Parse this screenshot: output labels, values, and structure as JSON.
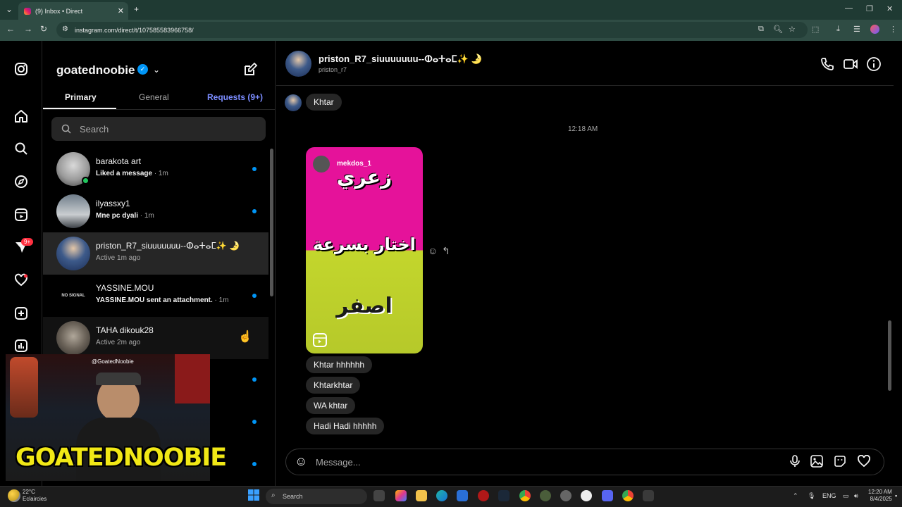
{
  "browser": {
    "tab_title": "(9) Inbox • Direct",
    "url": "instagram.com/direct/t/107585583966758/"
  },
  "rail": {
    "notification_badge": "9+"
  },
  "inbox": {
    "username": "goatednoobie",
    "tabs": [
      {
        "label": "Primary"
      },
      {
        "label": "General"
      },
      {
        "label": "Requests (9+)"
      }
    ],
    "search_placeholder": "Search",
    "threads": [
      {
        "name": "barakota art",
        "preview": "Liked a message",
        "time": " · 1m",
        "unread": true
      },
      {
        "name": "ilyassxy1",
        "preview": "Mne pc dyali",
        "time": " · 1m",
        "unread": true
      },
      {
        "name": "priston_R7_siuuuuuuu--ⵀⴰⵜⴰⵎ✨ 🌛",
        "preview": "Active 1m ago",
        "time": "",
        "unread": false
      },
      {
        "name": "YASSINE.MOU",
        "preview": "YASSINE.MOU sent an attachment.",
        "time": " · 1m",
        "unread": true
      },
      {
        "name": "TAHA dikouk28",
        "preview": "Active 2m ago",
        "time": "",
        "unread": false
      }
    ],
    "no_signal_label": "NO SIGNAL"
  },
  "webcam": {
    "tag": "@GoatedNoobie",
    "brand": "GOATEDNOOBIE"
  },
  "chat": {
    "name": "priston_R7_siuuuuuuu--ⵀⴰⵜⴰⵎ✨ 🌛",
    "handle": "priston_r7",
    "timestamp": "12:18 AM",
    "reel": {
      "author": "mekdos_1",
      "text_top": "زعري",
      "text_mid": "اختار بسرعة",
      "text_bottom": "اصفر"
    },
    "messages_before": [
      "Khtar"
    ],
    "messages_after": [
      "Khtar hhhhhh",
      "Khtarkhtar",
      "WA khtar",
      "Hadi Hadi hhhhh"
    ],
    "message_placeholder": "Message..."
  },
  "taskbar": {
    "weather_temp": "22°C",
    "weather_desc": "Eclaircies",
    "search_label": "Search",
    "language": "ENG",
    "time": "12:20 AM",
    "date": "8/4/2025"
  },
  "colors": {
    "accent_blue": "#0095f6",
    "requests_blue": "#7b8cff",
    "badge_red": "#ff3040",
    "reel_pink": "#e5129a",
    "reel_yellow": "#c3d62c",
    "brand_yellow": "#f1e816"
  }
}
